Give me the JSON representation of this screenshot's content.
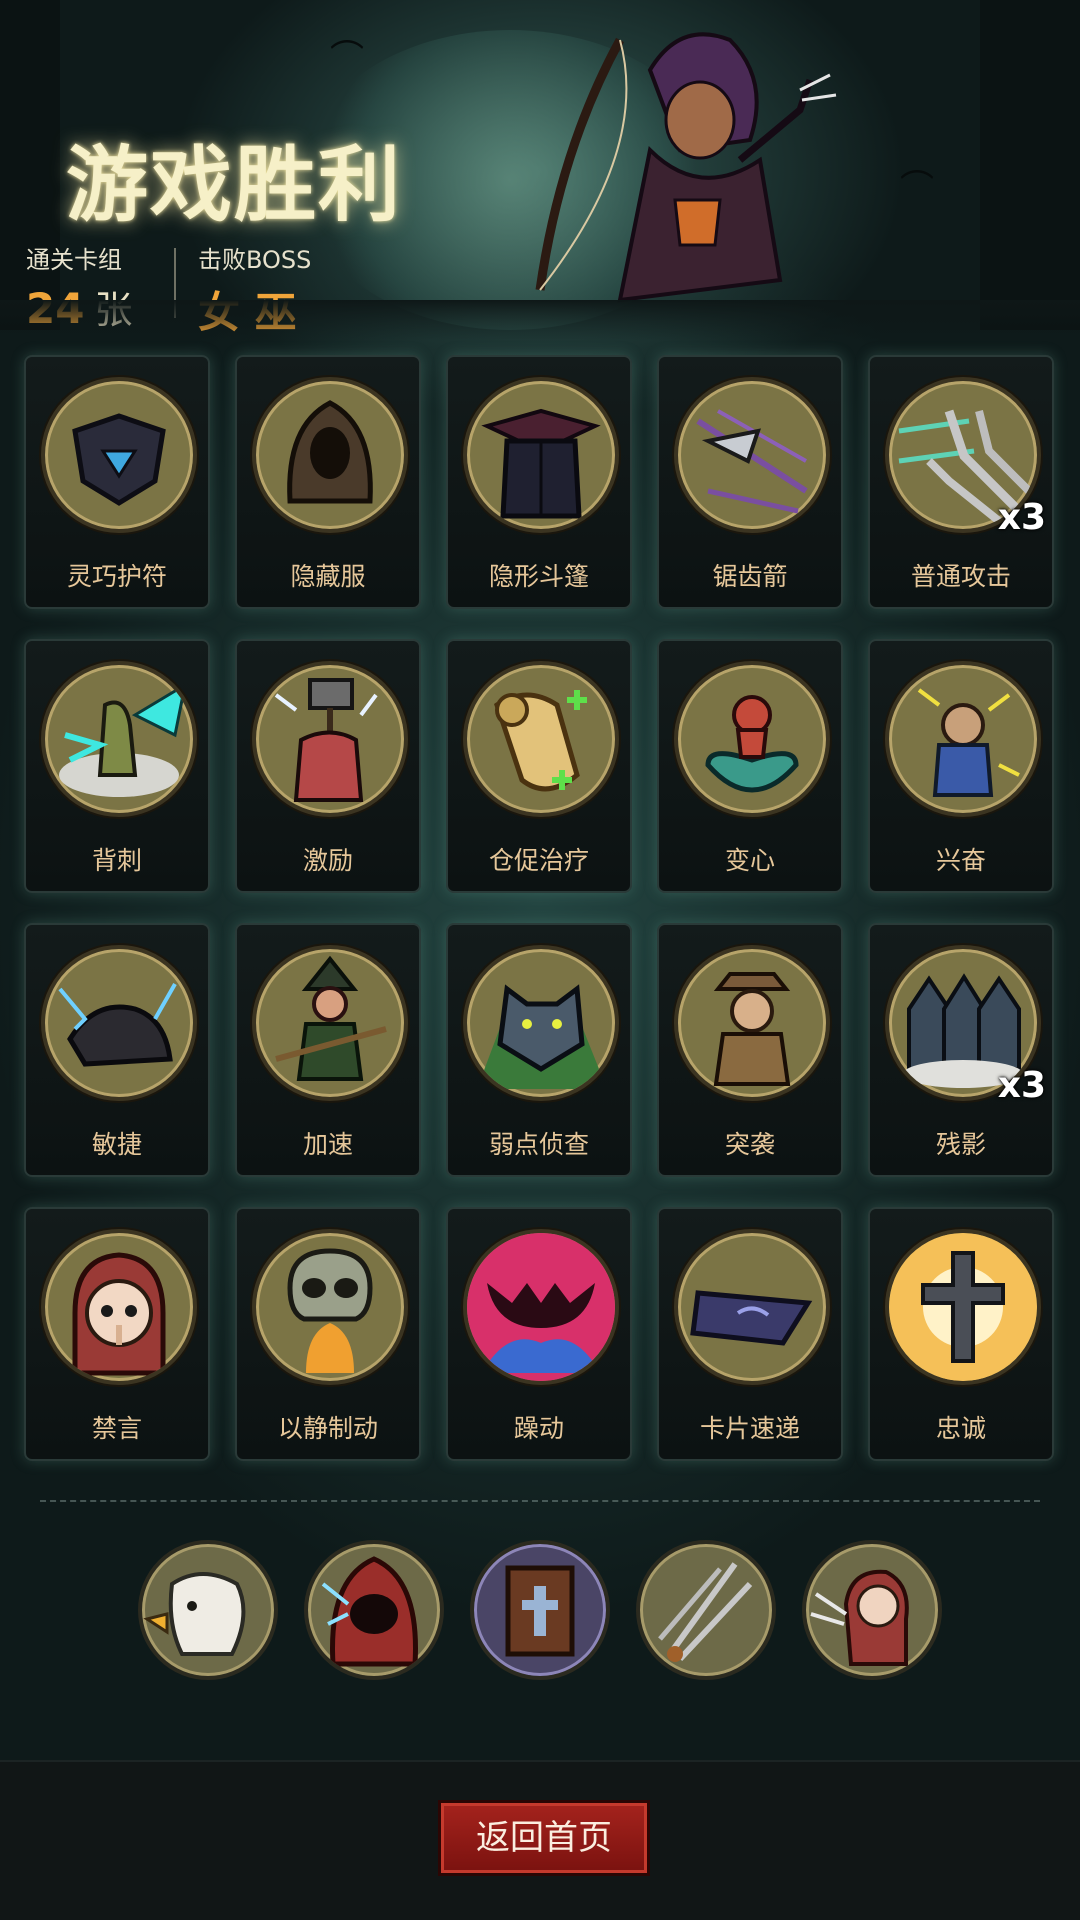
{
  "header": {
    "title": "游戏胜利",
    "stats": [
      {
        "label": "通关卡组",
        "value": "24",
        "unit": "张"
      },
      {
        "label": "击败BOSS",
        "value": "女 巫",
        "unit": ""
      }
    ]
  },
  "cards": [
    {
      "label": "灵巧护符",
      "icon": "shield-amulet-icon",
      "count": ""
    },
    {
      "label": "隐藏服",
      "icon": "hooded-cloak-icon",
      "count": ""
    },
    {
      "label": "隐形斗篷",
      "icon": "invisible-coat-icon",
      "count": ""
    },
    {
      "label": "锯齿箭",
      "icon": "serrated-arrow-icon",
      "count": ""
    },
    {
      "label": "普通攻击",
      "icon": "throwing-knives-icon",
      "count": "x3"
    },
    {
      "label": "背刺",
      "icon": "backstab-icon",
      "count": ""
    },
    {
      "label": "激励",
      "icon": "hammer-warrior-icon",
      "count": ""
    },
    {
      "label": "仓促治疗",
      "icon": "healing-scroll-icon",
      "count": ""
    },
    {
      "label": "变心",
      "icon": "imp-heart-icon",
      "count": ""
    },
    {
      "label": "兴奋",
      "icon": "excited-dwarf-icon",
      "count": ""
    },
    {
      "label": "敏捷",
      "icon": "panther-icon",
      "count": ""
    },
    {
      "label": "加速",
      "icon": "witch-broom-icon",
      "count": ""
    },
    {
      "label": "弱点侦查",
      "icon": "werewolf-icon",
      "count": ""
    },
    {
      "label": "突袭",
      "icon": "bandit-ambush-icon",
      "count": ""
    },
    {
      "label": "残影",
      "icon": "afterimage-icon",
      "count": "x3"
    },
    {
      "label": "禁言",
      "icon": "silence-girl-icon",
      "count": ""
    },
    {
      "label": "以静制动",
      "icon": "skull-flame-icon",
      "count": ""
    },
    {
      "label": "躁动",
      "icon": "frenzy-monster-icon",
      "count": ""
    },
    {
      "label": "卡片速递",
      "icon": "flying-card-icon",
      "count": ""
    },
    {
      "label": "忠诚",
      "icon": "cross-icon",
      "count": ""
    }
  ],
  "relics": [
    {
      "icon": "eagle-icon"
    },
    {
      "icon": "hooded-mage-icon"
    },
    {
      "icon": "holy-book-icon"
    },
    {
      "icon": "triple-blades-icon"
    },
    {
      "icon": "rogue-girl-icon"
    }
  ],
  "footer": {
    "home_button_label": "返回首页"
  },
  "colors": {
    "accent_orange": "#f0a53a",
    "card_label": "#e6c79a",
    "button_red": "#a5231d"
  }
}
